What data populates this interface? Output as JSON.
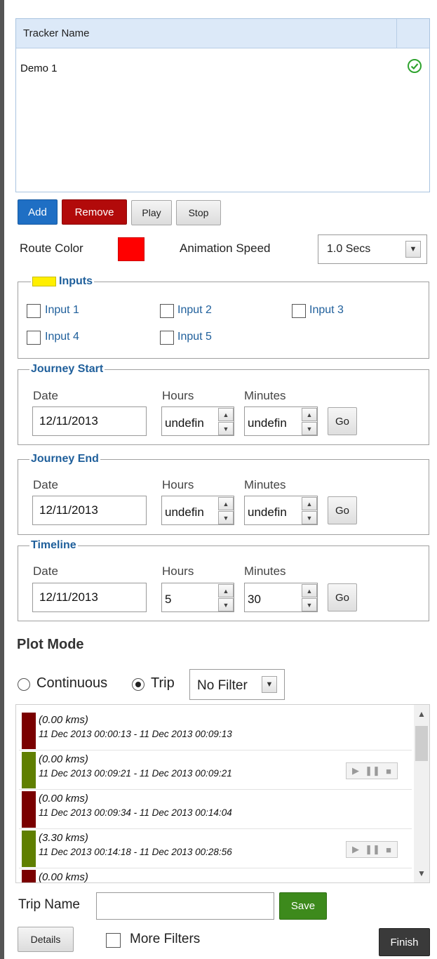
{
  "tracker_table": {
    "header": "Tracker Name",
    "rows": [
      {
        "name": "Demo 1",
        "status_icon": "check-circle-icon"
      }
    ]
  },
  "actions": {
    "add": "Add",
    "remove": "Remove",
    "play": "Play",
    "stop": "Stop"
  },
  "route": {
    "color_label": "Route Color",
    "color_value": "#ff0000",
    "speed_label": "Animation Speed",
    "speed_value": "1.0 Secs"
  },
  "inputs": {
    "legend": "Inputs",
    "legend_color": "#ffef00",
    "items": [
      "Input 1",
      "Input 2",
      "Input 3",
      "Input 4",
      "Input 5"
    ]
  },
  "labels": {
    "date": "Date",
    "hours": "Hours",
    "minutes": "Minutes",
    "go": "Go"
  },
  "journey_start": {
    "legend": "Journey Start",
    "date": "12/11/2013",
    "hours": "undefin",
    "minutes": "undefin"
  },
  "journey_end": {
    "legend": "Journey End",
    "date": "12/11/2013",
    "hours": "undefin",
    "minutes": "undefin"
  },
  "timeline": {
    "legend": "Timeline",
    "date": "12/11/2013",
    "hours": "5",
    "minutes": "30"
  },
  "plot_mode": {
    "title": "Plot Mode",
    "continuous": "Continuous",
    "trip": "Trip",
    "filter": "No Filter"
  },
  "trips": [
    {
      "distance": "(0.00 kms)",
      "range": "11 Dec 2013 00:00:13 - 11 Dec 2013 00:09:13",
      "color": "#7a0000",
      "controls": false
    },
    {
      "distance": "(0.00 kms)",
      "range": "11 Dec 2013 00:09:21 - 11 Dec 2013 00:09:21",
      "color": "#5f7f00",
      "controls": true
    },
    {
      "distance": "(0.00 kms)",
      "range": "11 Dec 2013 00:09:34 - 11 Dec 2013 00:14:04",
      "color": "#7a0000",
      "controls": false
    },
    {
      "distance": "(3.30 kms)",
      "range": "11 Dec 2013 00:14:18 - 11 Dec 2013 00:28:56",
      "color": "#5f7f00",
      "controls": true
    },
    {
      "distance": "(0.00 kms)",
      "range": "",
      "color": "#7a0000",
      "controls": false
    }
  ],
  "footer": {
    "trip_name_label": "Trip Name",
    "trip_name_value": "",
    "save": "Save",
    "details": "Details",
    "more_filters": "More Filters",
    "finish": "Finish"
  }
}
